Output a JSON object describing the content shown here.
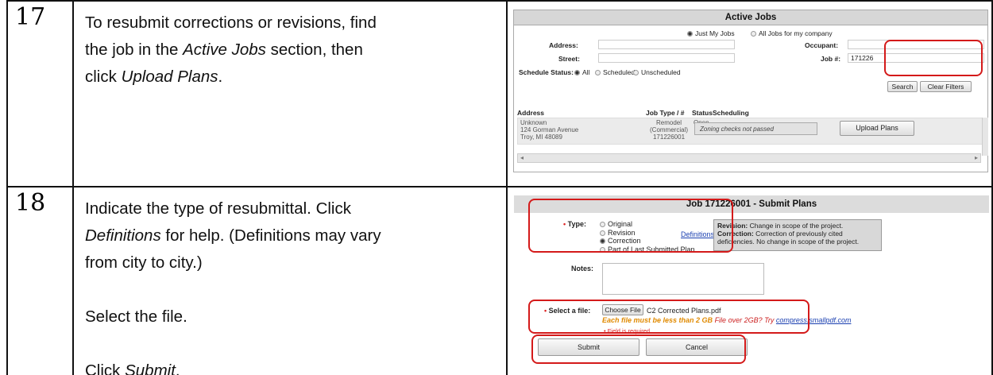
{
  "steps": [
    {
      "number": "17",
      "lines": [
        {
          "pre": "To resubmit corrections or revisions, find",
          "em": "",
          "post": ""
        },
        {
          "pre": "the job in the ",
          "em": "Active Jobs",
          "post": " section, then"
        },
        {
          "pre": "click ",
          "em": "Upload Plans",
          "post": "."
        }
      ]
    },
    {
      "number": "18",
      "lines": [
        {
          "pre": "Indicate the type of resubmittal.  Click",
          "em": "",
          "post": ""
        },
        {
          "pre": "",
          "em": "Definitions",
          "post": " for help.  (Definitions may vary"
        },
        {
          "pre": "from city to city.)",
          "em": "",
          "post": ""
        },
        {
          "pre": "Select the file.",
          "em": "",
          "post": ""
        },
        {
          "pre": "Click ",
          "em": "Submit",
          "post": "."
        }
      ]
    }
  ],
  "active_jobs": {
    "title": "Active Jobs",
    "scope_options": [
      "Just My Jobs",
      "All Jobs for my company"
    ],
    "labels": {
      "address": "Address:",
      "occupant": "Occupant:",
      "street": "Street:",
      "job_no": "Job #:",
      "schedule_status": "Schedule Status:"
    },
    "job_no_value": "171226",
    "status_options": [
      "All",
      "Scheduled",
      "Unscheduled"
    ],
    "search_label": "Search",
    "clear_label": "Clear Filters",
    "columns": [
      "Address",
      "Job Type / #",
      "Status",
      "Scheduling"
    ],
    "row": {
      "address": [
        "Unknown",
        "124 Gorman Avenue",
        "Troy, MI 48089"
      ],
      "job_type": [
        "Remodel",
        "(Commercial)",
        "171226001"
      ],
      "status": "Open",
      "scheduling_note": "Zoning checks not passed",
      "upload_label": "Upload Plans"
    }
  },
  "submit_plans": {
    "title": "Job 171226001 - Submit Plans",
    "required_mark": "•",
    "type_label": "Type:",
    "type_options": [
      "Original",
      "Revision",
      "Correction",
      "Part of Last Submitted Plan"
    ],
    "definitions_link": "Definitions",
    "revision_term": "Revision:",
    "revision_def": " Change in scope of the project.",
    "correction_term": "Correction:",
    "correction_def": " Correction of previously cited deficiencies. No change in scope of the project.",
    "notes_label": "Notes:",
    "file_label": "Select a file:",
    "choose_file": "Choose File",
    "file_name": "C2 Corrected Plans.pdf",
    "size_warning": "Each file must be less than 2 GB",
    "over_hint": "File over 2GB? Try ",
    "compress_link": "compress.smallpdf.com",
    "required_note": "• Field is required",
    "submit_label": "Submit",
    "cancel_label": "Cancel"
  },
  "colors": {
    "highlight": "#d41a1a",
    "link": "#1a3fb0",
    "warning": "#e08a00"
  }
}
